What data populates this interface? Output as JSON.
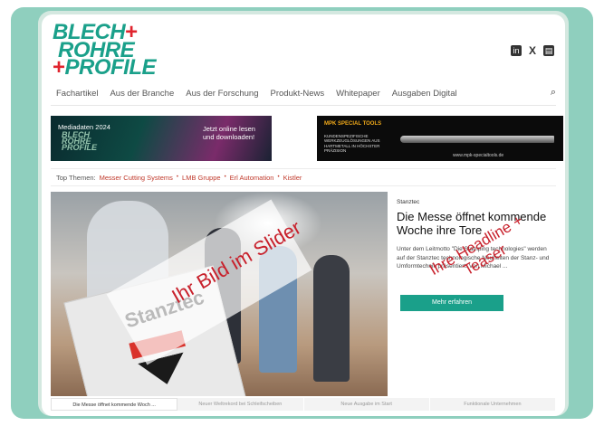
{
  "site": {
    "logo_lines": [
      "BLECH",
      "ROHRE",
      "PROFILE"
    ],
    "logo_plus": "+",
    "social": {
      "linkedin": "in",
      "x": "X",
      "rss": "▤"
    }
  },
  "nav": {
    "items": [
      "Fachartikel",
      "Aus der Branche",
      "Aus der Forschung",
      "Produkt-News",
      "Whitepaper",
      "Ausgaben Digital"
    ],
    "search_icon": "⌕"
  },
  "banner_left": {
    "title": "Mediadaten 2024",
    "logo_lines": [
      "BLECH",
      "ROHRE",
      "PROFILE"
    ],
    "cta": "Jetzt online lesen und downloaden!"
  },
  "banner_right": {
    "brand": "MPK SPECIAL TOOLS",
    "subtitle": "KUNDENSPEZIFISCHE WERKZEUGLÖSUNGEN AUS HARTMETALL IN HÖCHSTER PRÄZISION",
    "url": "www.mpk-specialtools.de"
  },
  "themes": {
    "label": "Top Themen:",
    "items": [
      "Messer Cutting Systems",
      "LMB Gruppe",
      "Erl Automation",
      "Kistler"
    ]
  },
  "slider": {
    "overlay_image_text": "Ihr Bild im Slider",
    "kicker": "Stanztec",
    "title": "Die Messe öffnet kommende Woche ihre Tore",
    "teaser": "Unter dem Leitmotto \"Die Stamping technologies\" werden auf der Stanztec technologische Neuheiten der Stanz- und Umformtechnik präsentiert. Von Michael ...",
    "overlay_headline_text": "Ihre Headline + Teaser",
    "button": "Mehr erfahren",
    "thumbs": [
      "Die Messe öffnet kommende Woch ...",
      "Neuer Weltrekord bei Schleifscheiben",
      "Neue Ausgabe im Start",
      "Funktionale Unternehmen"
    ]
  },
  "colors": {
    "accent": "#1aa08a",
    "brand_red": "#e0242e",
    "frame": "#8fcfbe"
  }
}
